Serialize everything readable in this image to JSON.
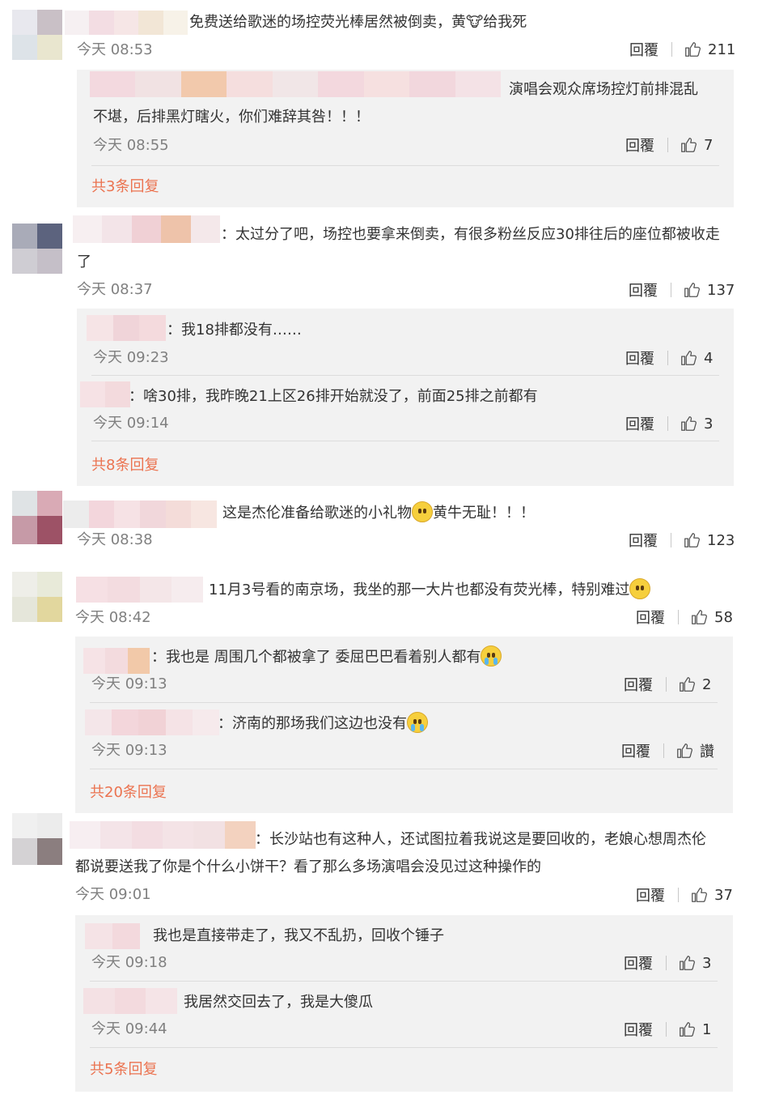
{
  "ui": {
    "reply_label": "回覆"
  },
  "comments": [
    {
      "text": "免费送给歌迷的场控荧光棒居然被倒卖，黄🐮给我死",
      "time": "今天 08:53",
      "likes": "211",
      "replies": [
        {
          "text": "演唱会观众席场控灯前排混乱",
          "text2": "不堪，后排黑灯瞎火，你们难辞其咎！！！",
          "time": "今天 08:55",
          "likes": "7"
        }
      ],
      "more": "共3条回复"
    },
    {
      "text": "：太过分了吧，场控也要拿来倒卖，有很多粉丝反应30排往后的座位都被收走",
      "text2": "了",
      "time": "今天 08:37",
      "likes": "137",
      "replies": [
        {
          "text": "：我18排都没有……",
          "time": "今天 09:23",
          "likes": "4"
        },
        {
          "text": "：啥30排，我昨晚21上区26排开始就没了，前面25排之前都有",
          "time": "今天 09:14",
          "likes": "3"
        }
      ],
      "more": "共8条回复"
    },
    {
      "text": "这是杰伦准备给歌迷的小礼物",
      "text_after": "黄牛无耻！！！",
      "time": "今天 08:38",
      "likes": "123"
    },
    {
      "text": "11月3号看的南京场，我坐的那一大片也都没有荧光棒，特别难过",
      "time": "今天 08:42",
      "likes": "58",
      "replies": [
        {
          "text": "：我也是 周围几个都被拿了 委屈巴巴看着别人都有",
          "time": "今天 09:13",
          "likes": "2"
        },
        {
          "text": "：济南的那场我们这边也没有",
          "time": "今天 09:13",
          "likes": "讚"
        }
      ],
      "more": "共20条回复"
    },
    {
      "text": "：长沙站也有这种人，还试图拉着我说这是要回收的，老娘心想周杰伦",
      "text2": "都说要送我了你是个什么小饼干？看了那么多场演唱会没见过这种操作的",
      "time": "今天 09:01",
      "likes": "37",
      "replies": [
        {
          "text": "我也是直接带走了，我又不乱扔，回收个锤子",
          "time": "今天 09:18",
          "likes": "3"
        },
        {
          "text": "我居然交回去了，我是大傻瓜",
          "time": "今天 09:44",
          "likes": "1"
        }
      ],
      "more": "共5条回复"
    }
  ]
}
